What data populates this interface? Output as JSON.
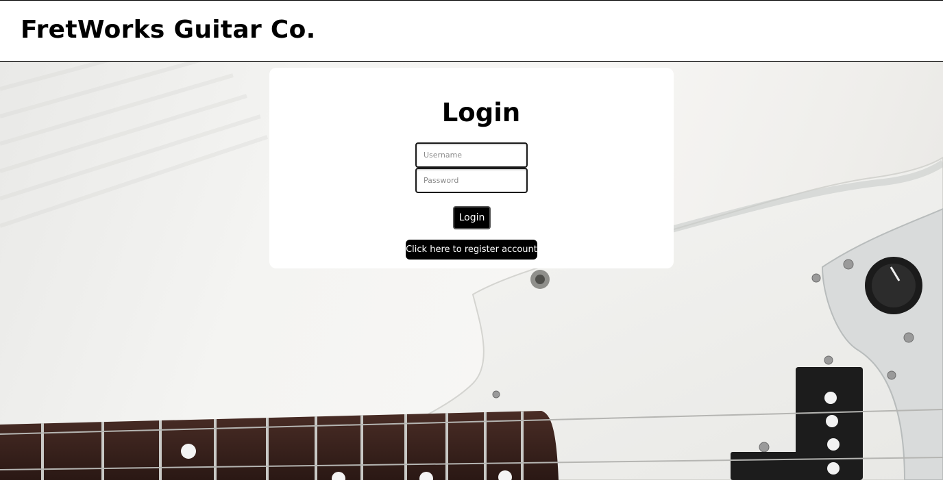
{
  "header": {
    "title": "FretWorks Guitar Co."
  },
  "login": {
    "title": "Login",
    "username_placeholder": "Username",
    "password_placeholder": "Password",
    "submit_label": "Login",
    "register_label": "Click here to register account"
  },
  "colors": {
    "button_bg": "#000000",
    "button_text": "#ffffff",
    "card_bg": "#ffffff",
    "fretboard": "#3a2420"
  }
}
